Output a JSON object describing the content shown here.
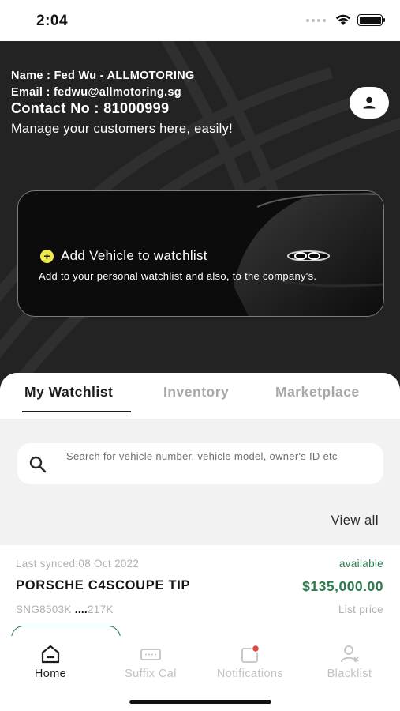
{
  "status_bar": {
    "time": "2:04"
  },
  "profile": {
    "name": "Name : Fed Wu - ALLMOTORING",
    "email": "Email : fedwu@allmotoring.sg",
    "contact": "Contact No : 81000999",
    "tagline": "Manage your customers here, easily!",
    "avatar_icon": "person-icon"
  },
  "add_vehicle_card": {
    "icon": "plus-circle-icon",
    "title": "Add Vehicle to watchlist",
    "description": "Add to your personal watchlist and also, to the company's."
  },
  "tabs": [
    {
      "label": "My Watchlist",
      "active": true
    },
    {
      "label": "Inventory",
      "active": false
    },
    {
      "label": "Marketplace",
      "active": false
    }
  ],
  "search": {
    "placeholder": "Search for vehicle number, vehicle model, owner's ID etc",
    "icon": "search-icon"
  },
  "view_all_label": "View all",
  "listing": {
    "last_synced": "Last synced:08 Oct 2022",
    "availability": "available",
    "model": "PORSCHE C4SCOUPE TIP",
    "price": "$135,000.00",
    "plate": "SNG8503K",
    "mileage_masked": "....",
    "mileage": "217K",
    "price_label": "List price"
  },
  "bottom_nav": [
    {
      "label": "Home",
      "icon": "home-icon",
      "active": true
    },
    {
      "label": "Suffix Cal",
      "icon": "calculator-plate-icon",
      "active": false
    },
    {
      "label": "Notifications",
      "icon": "bell-icon",
      "active": false
    },
    {
      "label": "Blacklist",
      "icon": "user-block-icon",
      "active": false
    }
  ],
  "colors": {
    "hero_background": "#232323",
    "accent_green": "#2d7a4f",
    "plus_yellow": "#f1e84b",
    "notification_red": "#e04848"
  }
}
